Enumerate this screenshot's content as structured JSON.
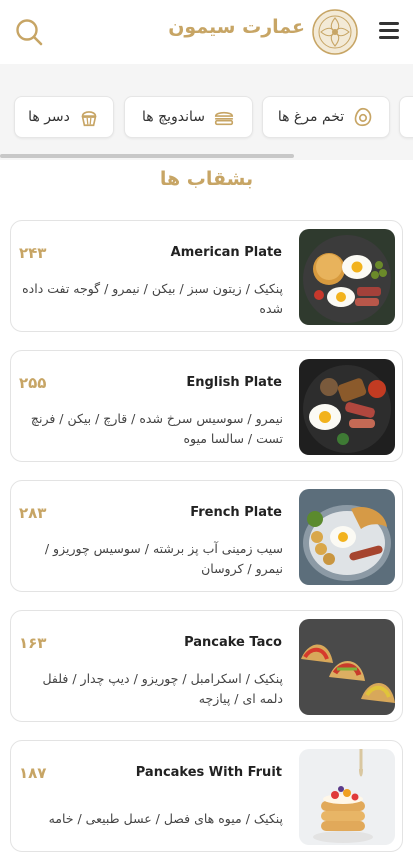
{
  "header": {
    "brand_name": "عمارت سیمون",
    "logo_icon": "floral-seal-logo",
    "menu_icon": "hamburger-menu-icon",
    "search_icon": "search-icon"
  },
  "categories": [
    {
      "label": "تخم مرغ ها",
      "icon": "egg-icon"
    },
    {
      "label": "ساندویچ ها",
      "icon": "sandwich-icon"
    },
    {
      "label": "دسر ها",
      "icon": "cupcake-icon"
    }
  ],
  "section": {
    "title": "بشقاب ها"
  },
  "items": [
    {
      "name": "American Plate",
      "price": "۲۴۳",
      "description": "پنکیک / زیتون سبز / بیکن / نیمرو / گوجه تفت داده شده",
      "image_icon": "american-plate-photo"
    },
    {
      "name": "English Plate",
      "price": "۲۵۵",
      "description": "نیمرو / سوسیس سرخ شده / قارچ / بیکن / فرنچ تست / سالسا میوه",
      "image_icon": "english-plate-photo"
    },
    {
      "name": "French Plate",
      "price": "۲۸۳",
      "description": "سیب زمینی آب پز برشته / سوسیس چوریزو / نیمرو / کروسان",
      "image_icon": "french-plate-photo"
    },
    {
      "name": "Pancake Taco",
      "price": "۱۶۳",
      "description": "پنکیک / اسکرامبل / چوریزو / دیپ چدار / فلفل دلمه ای / پیازچه",
      "image_icon": "pancake-taco-photo"
    },
    {
      "name": "Pancakes With Fruit",
      "price": "۱۸۷",
      "description": "پنکیک / میوه های فصل / عسل طبیعی / خامه",
      "image_icon": "pancakes-fruit-photo"
    }
  ],
  "colors": {
    "accent": "#c7a565",
    "strip_bg": "#f5f5f5"
  }
}
